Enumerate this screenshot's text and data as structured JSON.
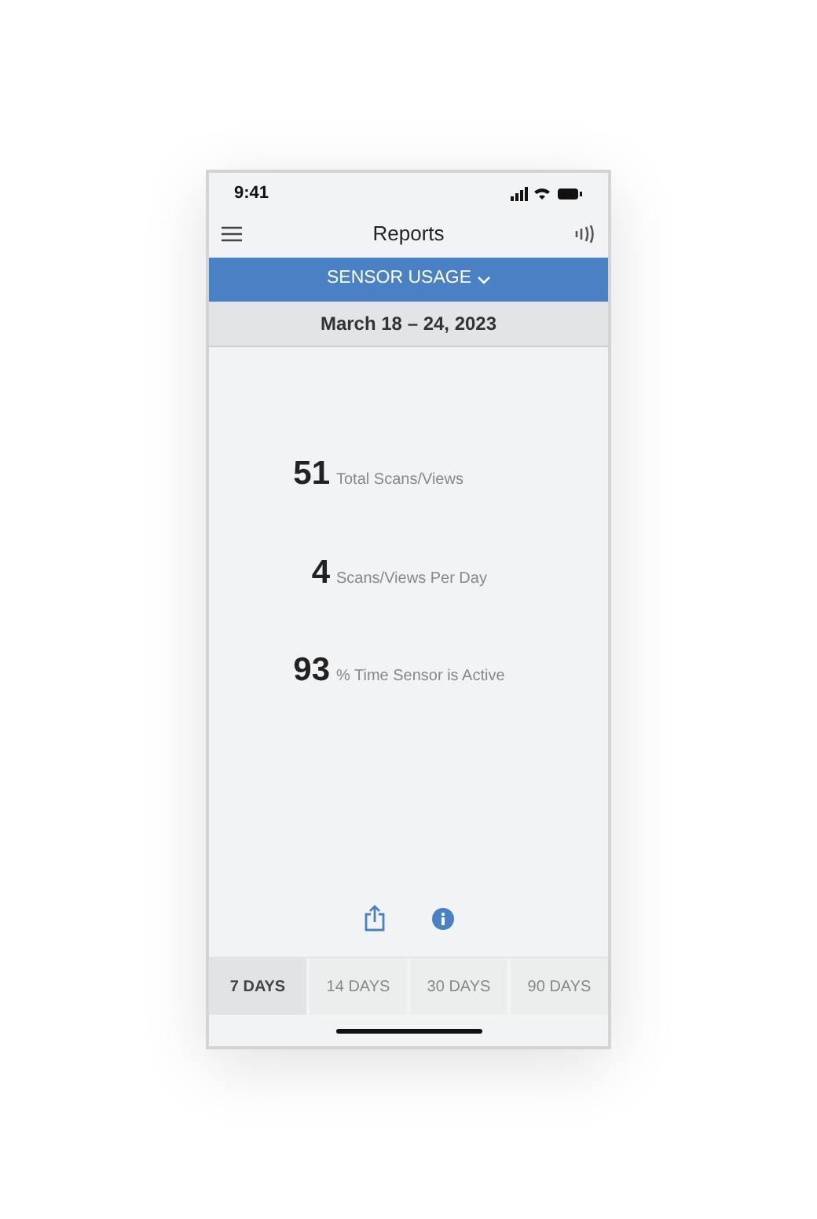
{
  "status_bar": {
    "time": "9:41"
  },
  "header": {
    "title": "Reports"
  },
  "report_selector": {
    "label": "SENSOR USAGE"
  },
  "date_range": "March 18 – 24, 2023",
  "stats": [
    {
      "value": "51",
      "label": "Total Scans/Views"
    },
    {
      "value": "4",
      "label": "Scans/Views Per Day"
    },
    {
      "value": "93",
      "label": "% Time Sensor is Active"
    }
  ],
  "tabs": [
    {
      "label": "7 DAYS",
      "selected": true
    },
    {
      "label": "14 DAYS",
      "selected": false
    },
    {
      "label": "30 DAYS",
      "selected": false
    },
    {
      "label": "90 DAYS",
      "selected": false
    }
  ]
}
